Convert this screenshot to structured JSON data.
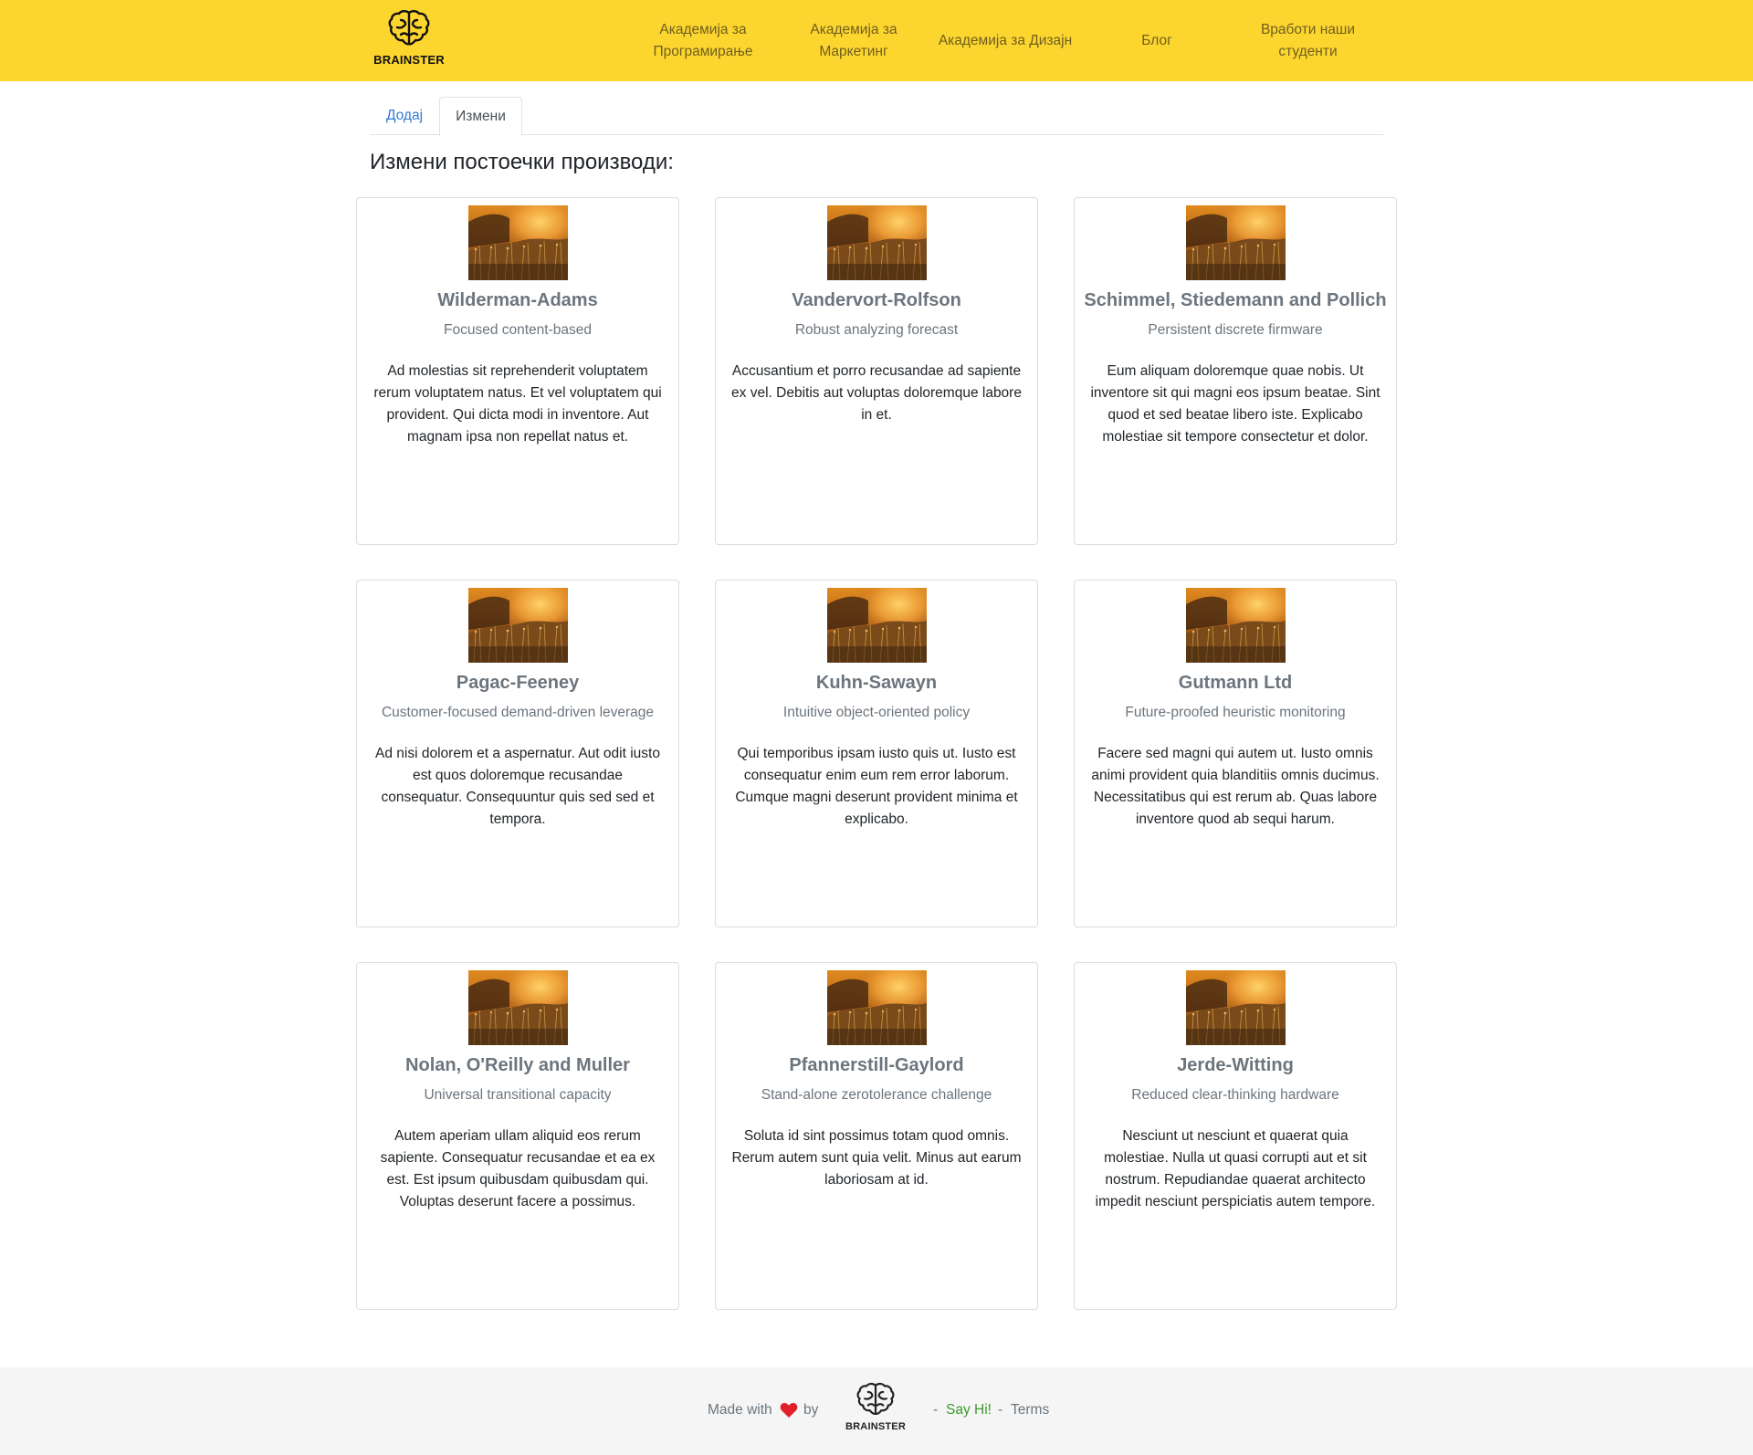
{
  "header": {
    "brand": "BRAINSTER",
    "nav": [
      {
        "label": "Академија за Програмирање"
      },
      {
        "label": "Академија за Маркетинг"
      },
      {
        "label": "Академија за Дизајн"
      },
      {
        "label": "Блог"
      },
      {
        "label": "Вработи наши студенти"
      }
    ]
  },
  "tabs": {
    "add": "Додај",
    "edit": "Измени"
  },
  "main": {
    "title": "Измени постоечки производи:"
  },
  "cards": [
    {
      "title": "Wilderman-Adams",
      "subtitle": "Focused content-based",
      "text": "Ad molestias sit reprehenderit voluptatem rerum voluptatem natus. Et vel voluptatem qui provident. Qui dicta modi in inventore. Aut magnam ipsa non repellat natus et."
    },
    {
      "title": "Vandervort-Rolfson",
      "subtitle": "Robust analyzing forecast",
      "text": "Accusantium et porro recusandae ad sapiente ex vel. Debitis aut voluptas doloremque labore in et."
    },
    {
      "title": "Schimmel, Stiedemann and Pollich",
      "subtitle": "Persistent discrete firmware",
      "text": "Eum aliquam doloremque quae nobis. Ut inventore sit qui magni eos ipsum beatae. Sint quod et sed beatae libero iste. Explicabo molestiae sit tempore consectetur et dolor."
    },
    {
      "title": "Pagac-Feeney",
      "subtitle": "Customer-focused demand-driven leverage",
      "text": "Ad nisi dolorem et a aspernatur. Aut odit iusto est quos doloremque recusandae consequatur. Consequuntur quis sed sed et tempora."
    },
    {
      "title": "Kuhn-Sawayn",
      "subtitle": "Intuitive object-oriented policy",
      "text": "Qui temporibus ipsam iusto quis ut. Iusto est consequatur enim eum rem error laborum. Cumque magni deserunt provident minima et explicabo."
    },
    {
      "title": "Gutmann Ltd",
      "subtitle": "Future-proofed heuristic monitoring",
      "text": "Facere sed magni qui autem ut. Iusto omnis animi provident quia blanditiis omnis ducimus. Necessitatibus qui est rerum ab. Quas labore inventore quod ab sequi harum."
    },
    {
      "title": "Nolan, O'Reilly and Muller",
      "subtitle": "Universal transitional capacity",
      "text": "Autem aperiam ullam aliquid eos rerum sapiente. Consequatur recusandae et ea ex est. Est ipsum quibusdam quibusdam qui. Voluptas deserunt facere a possimus."
    },
    {
      "title": "Pfannerstill-Gaylord",
      "subtitle": "Stand-alone zerotolerance challenge",
      "text": "Soluta id sint possimus totam quod omnis. Rerum autem sunt quia velit. Minus aut earum laboriosam at id."
    },
    {
      "title": "Jerde-Witting",
      "subtitle": "Reduced clear-thinking hardware",
      "text": "Nesciunt ut nesciunt et quaerat quia molestiae. Nulla ut quasi corrupti aut et sit nostrum. Repudiandae quaerat architecto impedit nesciunt perspiciatis autem tempore."
    }
  ],
  "footer": {
    "made_with": "Made with",
    "by": "by",
    "brand": "BRAINSTER",
    "sep": "-",
    "say_hi": "Say Hi!",
    "terms": "Terms"
  },
  "colors": {
    "navbar_bg": "#fdd52f",
    "tab_active_link": "#2f7bd6",
    "say_hi": "#3c9a2d",
    "heart": "#e0202b"
  },
  "icons": {
    "brand_logo": "brain-logo-icon",
    "heart": "heart-icon",
    "product_image": "field-sunset-image"
  }
}
